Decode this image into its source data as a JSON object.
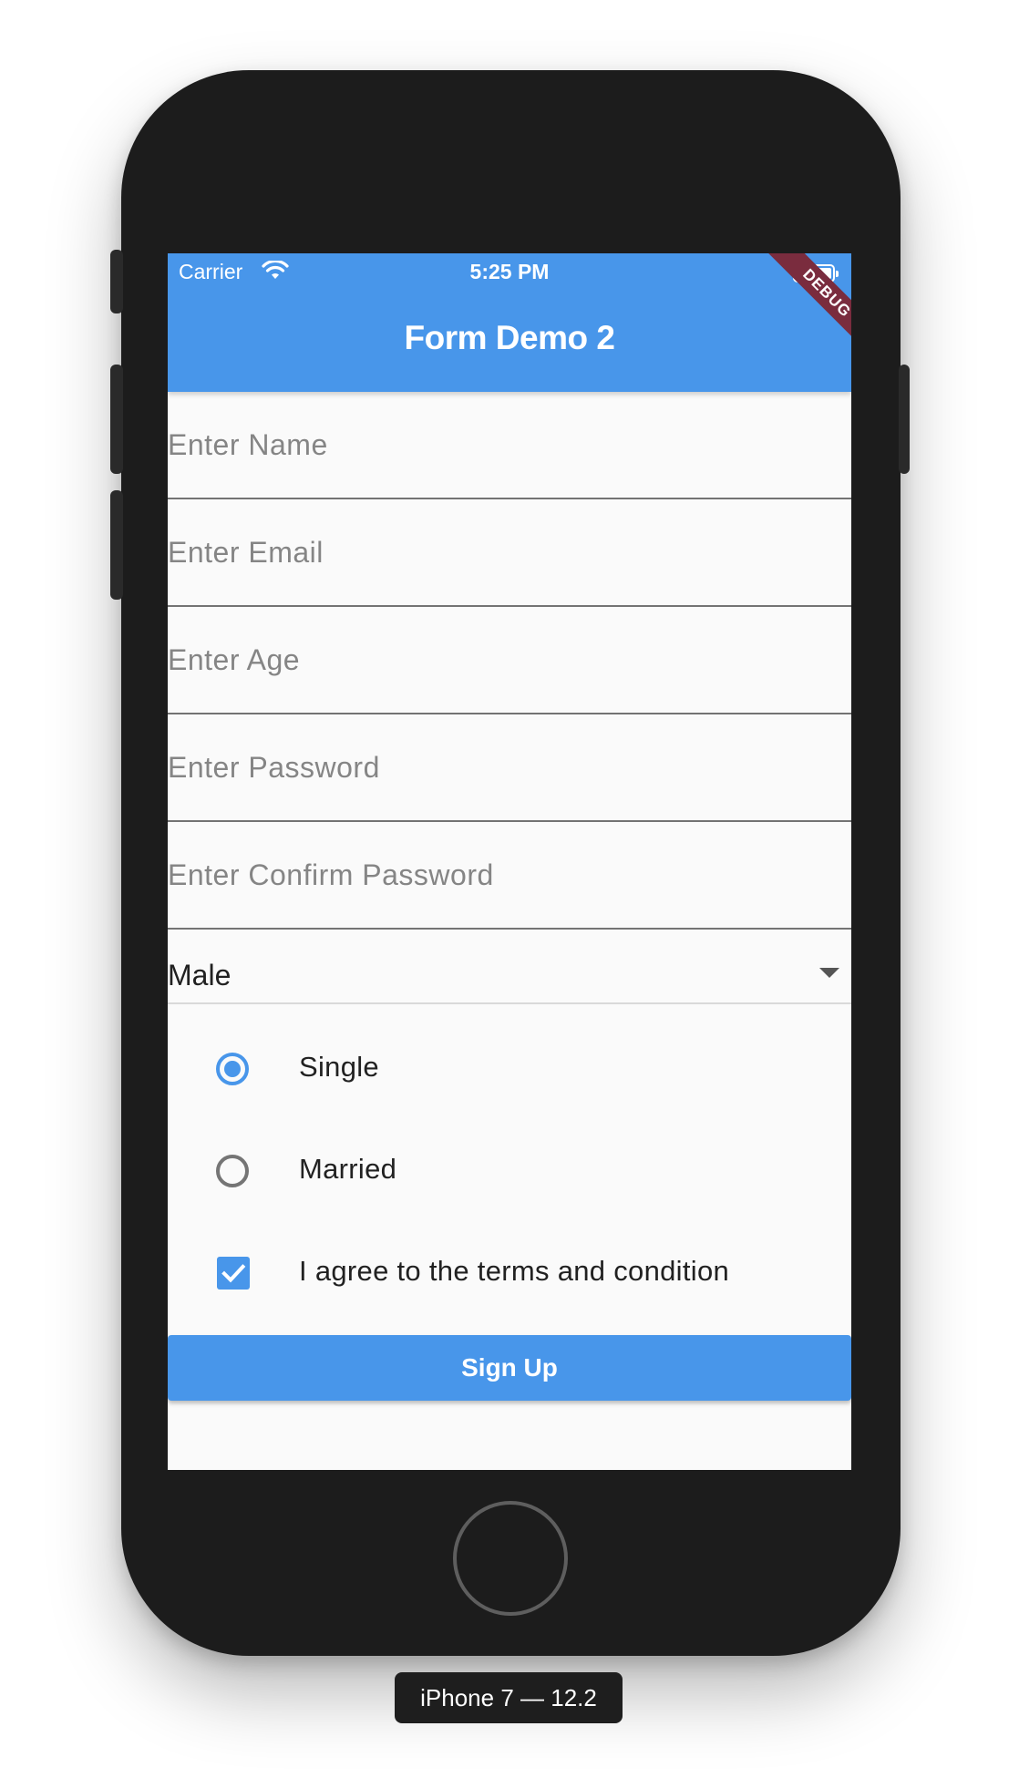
{
  "status_bar": {
    "carrier": "Carrier",
    "time": "5:25 PM"
  },
  "app_bar": {
    "title": "Form Demo 2",
    "debug_banner": "DEBUG",
    "color": "#4896ea"
  },
  "form": {
    "fields": [
      {
        "placeholder": "Enter Name",
        "value": ""
      },
      {
        "placeholder": "Enter Email",
        "value": ""
      },
      {
        "placeholder": "Enter Age",
        "value": ""
      },
      {
        "placeholder": "Enter Password",
        "value": ""
      },
      {
        "placeholder": "Enter Confirm Password",
        "value": ""
      }
    ],
    "gender_dropdown": {
      "selected": "Male"
    },
    "marital_status": {
      "options": [
        {
          "label": "Single",
          "selected": true
        },
        {
          "label": "Married",
          "selected": false
        }
      ]
    },
    "terms": {
      "label": "I agree to the terms and condition",
      "checked": true
    },
    "submit_label": "Sign Up"
  },
  "device": {
    "label": "iPhone 7 — 12.2"
  }
}
